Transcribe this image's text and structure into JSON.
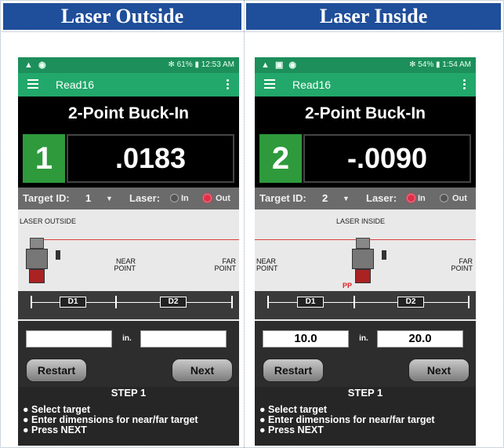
{
  "headers": {
    "left": "Laser Outside",
    "right": "Laser Inside"
  },
  "panels": [
    {
      "status_left": "▲ ◉",
      "status_right": "✻ 61% ▮ 12:53 AM",
      "app_name": "Read16",
      "screen_title": "2-Point Buck-In",
      "target_number": "1",
      "reading": ".0183",
      "target_id_label": "Target ID:",
      "target_id_value": "1",
      "laser_label": "Laser:",
      "laser_in_label": "In",
      "laser_out_label": "Out",
      "laser_mode": "Out",
      "diagram_caption": "LASER OUTSIDE",
      "near_point_label": "NEAR POINT",
      "far_point_label": "FAR POINT",
      "pp_label": "",
      "d1_label": "D1",
      "d2_label": "D2",
      "near_value": "",
      "unit_label": "in.",
      "far_value": "",
      "restart_label": "Restart",
      "next_label": "Next",
      "step_title": "STEP 1",
      "step_lines": [
        "● Select target",
        "● Enter dimensions for near/far target",
        "● Press NEXT"
      ]
    },
    {
      "status_left": "▲ ▣ ◉",
      "status_right": "✻ 54% ▮ 1:54 AM",
      "app_name": "Read16",
      "screen_title": "2-Point Buck-In",
      "target_number": "2",
      "reading": "-.0090",
      "target_id_label": "Target ID:",
      "target_id_value": "2",
      "laser_label": "Laser:",
      "laser_in_label": "In",
      "laser_out_label": "Out",
      "laser_mode": "In",
      "diagram_caption": "LASER INSIDE",
      "near_point_label": "NEAR POINT",
      "far_point_label": "FAR POINT",
      "pp_label": "PP",
      "d1_label": "D1",
      "d2_label": "D2",
      "near_value": "10.0",
      "unit_label": "in.",
      "far_value": "20.0",
      "restart_label": "Restart",
      "next_label": "Next",
      "step_title": "STEP 1",
      "step_lines": [
        "● Select target",
        "● Enter dimensions for near/far target",
        "● Press NEXT"
      ]
    }
  ]
}
